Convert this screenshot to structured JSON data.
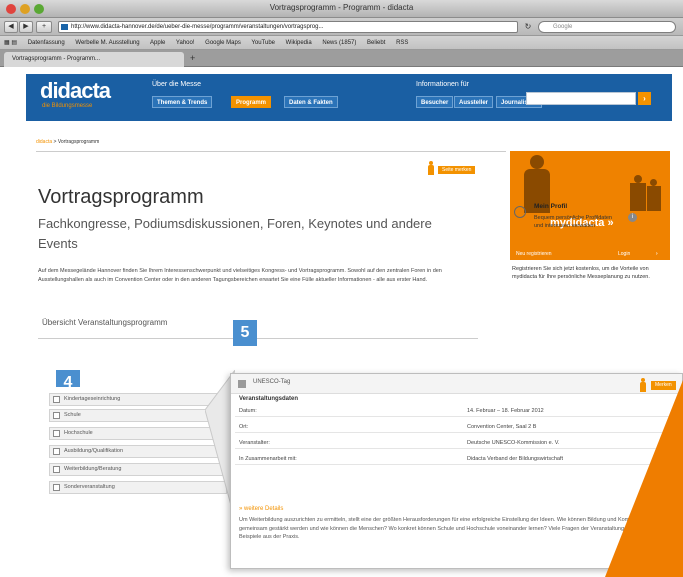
{
  "browser": {
    "window_title": "Vortragsprogramm - Programm - didacta",
    "url": "http://www.didacta-hannover.de/de/ueber-die-messe/programm/veranstaltungen/vortragsprog...",
    "search_placeholder": "Google",
    "bookmarks": [
      "Datenfassung",
      "Werbelle M. Ausstellung",
      "Apple",
      "Yahoo!",
      "Google Maps",
      "YouTube",
      "Wikipedia",
      "News (1857)",
      "Beliebt",
      "RSS"
    ],
    "tab_label": "Vortragsprogramm - Programm..."
  },
  "site": {
    "logo": "didacta",
    "logo_sub": "die Bildungsmesse",
    "label_about": "Über die Messe",
    "label_info": "Informationen für",
    "nav_left": [
      "Themen & Trends",
      "Programm",
      "Daten & Fakten"
    ],
    "nav_right": [
      "Besucher",
      "Aussteller",
      "Journalisten"
    ],
    "search_button": "›"
  },
  "page": {
    "breadcrumb_home": "didacta",
    "breadcrumb_sep": " > ",
    "breadcrumb_current": "Vortragsprogramm",
    "merken_label": "Seite merken",
    "title": "Vortragsprogramm",
    "subtitle": "Fachkongresse, Podiumsdiskussionen, Foren, Keynotes und andere Events",
    "intro": "Auf dem Messegelände Hannover finden Sie Ihrem Interessenschwerpunkt und vielseitiges Kongress- und Vortragsprogramm. Sowohl auf den zentralen Foren in den Ausstellungshallen als auch im Convention Center oder in den anderen Tagungsbereichen erwartet Sie eine Fülle aktueller Informationen - alle aus erster Hand.",
    "overview_label": "Übersicht Veranstaltungsprogramm"
  },
  "sidebar": {
    "hero_text": "mydidacta »",
    "link_register": "Neu registrieren",
    "link_login": "Login",
    "register_text": "Registrieren Sie sich jetzt kostenlos, um die Vorteile von mydidacta für Ihre persönliche Messeplanung zu nutzen.",
    "profil_title": "Mein Profil",
    "profil_desc": "Bequem persönliche Profildaten und interessen verwalten",
    "info_glyph": "i"
  },
  "badges": {
    "left": "4",
    "right": "5"
  },
  "filter_panel": {
    "items": [
      "Kindertageseinrichtung",
      "Schule",
      "Hochschule",
      "Ausbildung/Qualifikation",
      "Weiterbildung/Beratung",
      "Sonderveranstaltung"
    ]
  },
  "detail_panel": {
    "event_title": "UNESCO-Tag",
    "merken_label": "Merken",
    "section_title": "Veranstaltungsdaten",
    "rows": [
      {
        "k": "Datum:",
        "v": "14. Februar – 18. Februar 2012"
      },
      {
        "k": "Ort:",
        "v": "Convention Center, Saal 2 B"
      },
      {
        "k": "Veranstalter:",
        "v": "Deutsche UNESCO-Kommission e. V."
      },
      {
        "k": "In Zusammenarbeit mit:",
        "v": "Didacta Verband der Bildungswirtschaft"
      }
    ],
    "more_label": "» weitere Details",
    "detail_text": "Um Weiterbildung auszurichten zu ermitteln, stellt eine der größten Herausforderungen für eine erfolgreiche Einstellung der Ideen. Wie können Bildung und Kompetenz gemeinsam gestärkt werden und wie können die Menschen? Wo konkret können Schule und Hochschule voneinander lernen? Viele Fragen der Veranstaltungen und Beispiele aus der Praxis."
  }
}
